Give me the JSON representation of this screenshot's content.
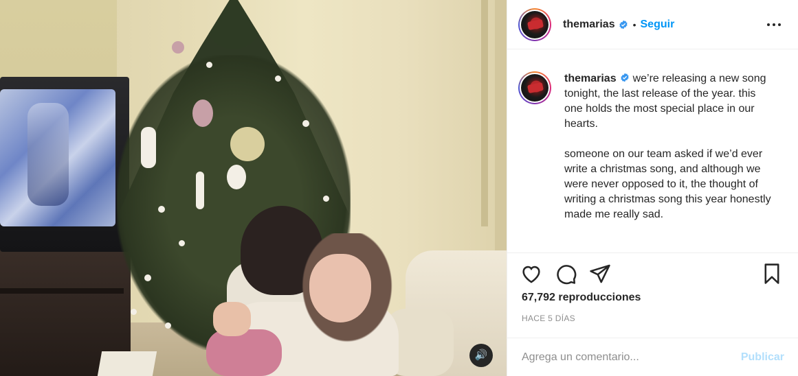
{
  "media": {
    "audio_icon": "speaker-icon",
    "audio_glyph": "🔊"
  },
  "header": {
    "username": "themarias",
    "separator": "•",
    "follow_label": "Seguir",
    "more_icon": "more-horizontal-icon"
  },
  "caption": {
    "username": "themarias",
    "paragraphs": [
      "we’re releasing a new song tonight, the last release of the year. this one holds the most special place in our hearts.",
      "someone on our team asked if we’d ever write a christmas song, and although we were never opposed to it, the thought of writing a christmas song this year honestly made me really sad."
    ]
  },
  "actions": {
    "like_icon": "heart-icon",
    "comment_icon": "comment-icon",
    "share_icon": "share-icon",
    "save_icon": "bookmark-icon"
  },
  "stats": {
    "views": "67,792 reproducciones",
    "time": "HACE 5 DÍAS"
  },
  "comment_box": {
    "placeholder": "Agrega un comentario...",
    "publish_label": "Publicar"
  },
  "colors": {
    "accent": "#0095f6",
    "publish_disabled": "#b2dffc",
    "text": "#262626",
    "muted": "#8e8e8e",
    "verified": "#3897f0"
  }
}
